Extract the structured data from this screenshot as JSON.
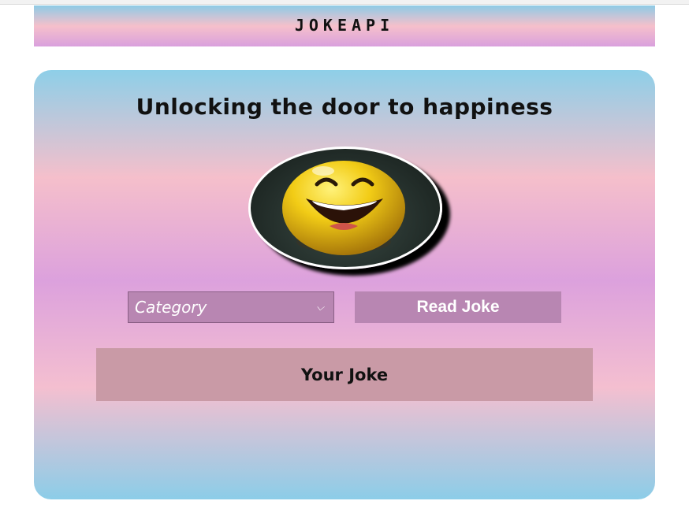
{
  "header": {
    "title": "JOKEAPI"
  },
  "card": {
    "heading": "Unlocking the door to happiness",
    "avatar_icon": "laughing-smiley-face-icon"
  },
  "controls": {
    "category_value": "Category",
    "read_button_label": "Read Joke",
    "chevron_icon": "chevron-down-icon"
  },
  "joke": {
    "text": "Your Joke"
  },
  "colors": {
    "gradient_blue": "#8ecfe8",
    "gradient_pink": "#f5bfcb",
    "gradient_violet": "#dca1dd",
    "control_purple": "#b886b2",
    "joke_box": "#c99aa6"
  }
}
